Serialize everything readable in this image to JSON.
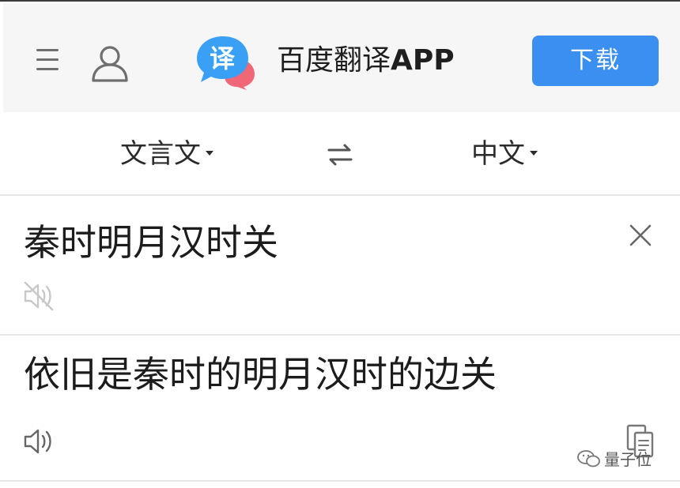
{
  "header": {
    "app_name": "百度翻译",
    "app_suffix": "APP",
    "download_label": "下载",
    "logo_glyph": "译",
    "icons": [
      "menu-icon",
      "user-icon",
      "app-logo"
    ]
  },
  "lang_bar": {
    "source_lang": "文言文",
    "target_lang": "中文",
    "swap_icon": "swap-arrows-icon"
  },
  "input": {
    "text": "秦时明月汉时关",
    "icons": [
      "close-icon",
      "speaker-muted-icon"
    ]
  },
  "result": {
    "text": "依旧是秦时的明月汉时的边关",
    "icons": [
      "speaker-icon",
      "copy-icon"
    ]
  },
  "watermark": {
    "text": "量子位"
  },
  "colors": {
    "accent": "#3b8ff0",
    "header_bg": "#f6f6f6",
    "logo_blue": "#3aa0f5",
    "logo_pink": "#f06878",
    "divider": "#e7e7e7"
  }
}
